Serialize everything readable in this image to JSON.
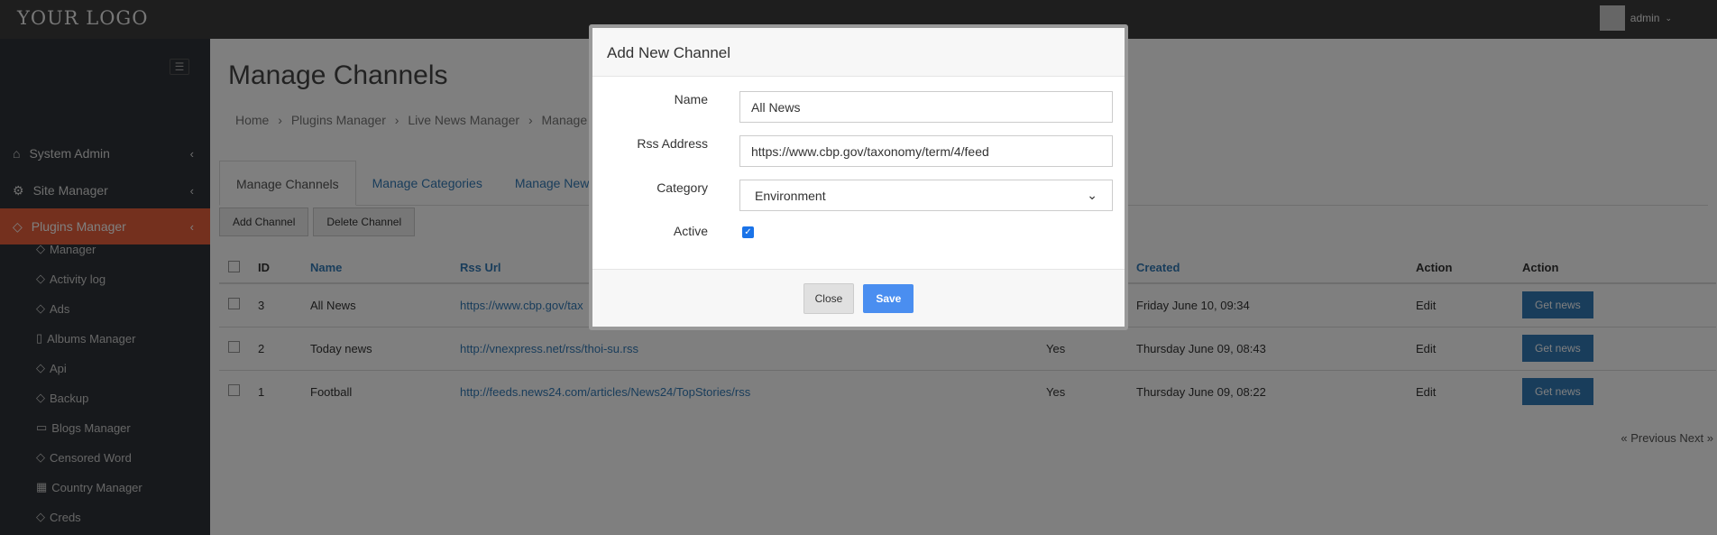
{
  "topbar": {
    "logo": "YOUR LOGO",
    "user": "admin",
    "caret": "⌄"
  },
  "sidebar": {
    "toggle": "☰",
    "nav": [
      {
        "label": "System Admin",
        "icon": "⌂",
        "chev": "‹"
      },
      {
        "label": "Site Manager",
        "icon": "⚙",
        "chev": "‹"
      },
      {
        "label": "Plugins Manager",
        "icon": "◇",
        "chev": "‹"
      }
    ],
    "sub": [
      {
        "label": "Manager",
        "icon": "◇"
      },
      {
        "label": "Activity log",
        "icon": "◇"
      },
      {
        "label": "Ads",
        "icon": "◇"
      },
      {
        "label": "Albums Manager",
        "icon": "▯"
      },
      {
        "label": "Api",
        "icon": "◇"
      },
      {
        "label": "Backup",
        "icon": "◇"
      },
      {
        "label": "Blogs Manager",
        "icon": "▭"
      },
      {
        "label": "Censored Word",
        "icon": "◇"
      },
      {
        "label": "Country Manager",
        "icon": "▦"
      },
      {
        "label": "Creds",
        "icon": "◇"
      }
    ]
  },
  "main": {
    "title": "Manage Channels",
    "breadcrumb": [
      "Home",
      "›",
      "Plugins Manager",
      "›",
      "Live News Manager",
      "›",
      "Manage Ch"
    ],
    "tabs": [
      "Manage Channels",
      "Manage Categories",
      "Manage News"
    ],
    "buttons": {
      "add": "Add Channel",
      "delete": "Delete Channel"
    },
    "table": {
      "headers": [
        "ID",
        "Name",
        "Rss Url",
        "",
        "Created",
        "Action",
        "Action"
      ],
      "rows": [
        {
          "id": "3",
          "name": "All News",
          "url": "https://www.cbp.gov/tax",
          "active": "",
          "created": "Friday June 10, 09:34",
          "edit": "Edit",
          "get": "Get news"
        },
        {
          "id": "2",
          "name": "Today news",
          "url": "http://vnexpress.net/rss/thoi-su.rss",
          "active": "Yes",
          "created": "Thursday June 09, 08:43",
          "edit": "Edit",
          "get": "Get news"
        },
        {
          "id": "1",
          "name": "Football",
          "url": "http://feeds.news24.com/articles/News24/TopStories/rss",
          "active": "Yes",
          "created": "Thursday June 09, 08:22",
          "edit": "Edit",
          "get": "Get news"
        }
      ]
    },
    "pager": {
      "prev": "« Previous",
      "next": "Next »"
    }
  },
  "modal": {
    "title": "Add New Channel",
    "fields": {
      "name_label": "Name",
      "name_value": "All News",
      "rss_label": "Rss Address",
      "rss_value": "https://www.cbp.gov/taxonomy/term/4/feed",
      "category_label": "Category",
      "category_value": "Environment",
      "category_caret": "⌄",
      "active_label": "Active",
      "active_checked": true,
      "check_mark": "✓"
    },
    "close_label": "Close",
    "save_label": "Save"
  },
  "colors": {
    "accent": "#e8603c",
    "link": "#337ab7",
    "save": "#4a8ef0"
  }
}
